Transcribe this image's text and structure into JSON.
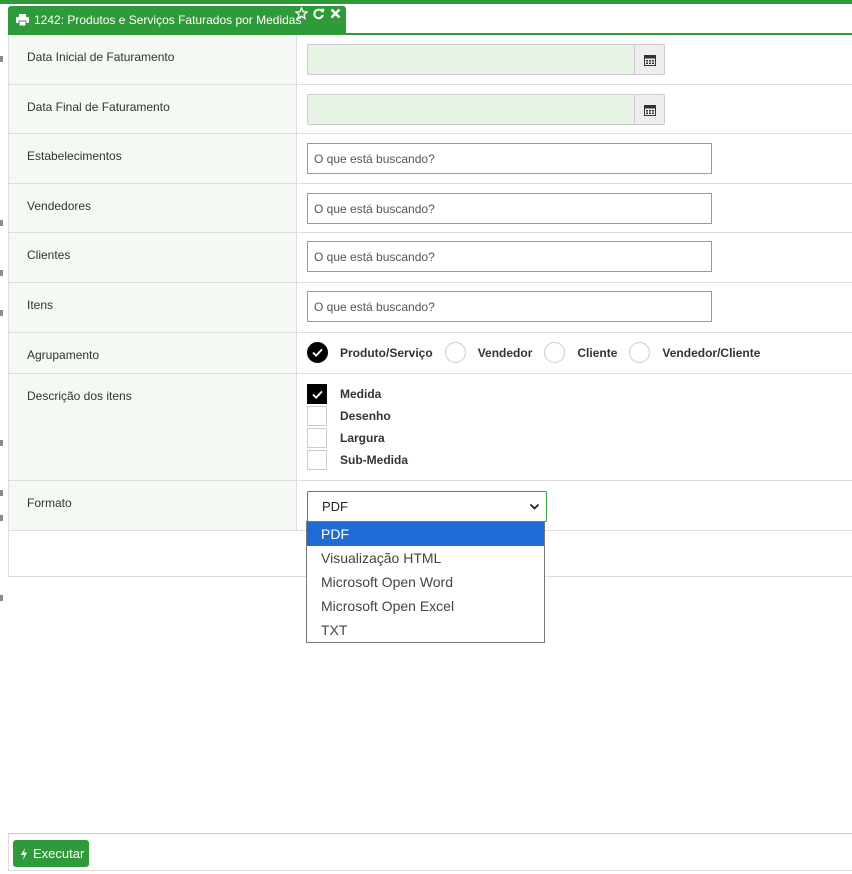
{
  "tab": {
    "title": "1242: Produtos e Serviços Faturados por Medidas",
    "icon": "printer-icon",
    "actions": [
      "star-icon",
      "refresh-icon",
      "close-icon"
    ]
  },
  "form": {
    "data_inicial": {
      "label": "Data Inicial de Faturamento",
      "value": ""
    },
    "data_final": {
      "label": "Data Final de Faturamento",
      "value": ""
    },
    "estabelecimentos": {
      "label": "Estabelecimentos",
      "placeholder": "O que está buscando?"
    },
    "vendedores": {
      "label": "Vendedores",
      "placeholder": "O que está buscando?"
    },
    "clientes": {
      "label": "Clientes",
      "placeholder": "O que está buscando?"
    },
    "itens": {
      "label": "Itens",
      "placeholder": "O que está buscando?"
    },
    "agrupamento": {
      "label": "Agrupamento",
      "options": [
        "Produto/Serviço",
        "Vendedor",
        "Cliente",
        "Vendedor/Cliente"
      ],
      "selected": "Produto/Serviço"
    },
    "descricao": {
      "label": "Descrição dos itens",
      "options": [
        {
          "label": "Medida",
          "checked": true
        },
        {
          "label": "Desenho",
          "checked": false
        },
        {
          "label": "Largura",
          "checked": false
        },
        {
          "label": "Sub-Medida",
          "checked": false
        }
      ]
    },
    "formato": {
      "label": "Formato",
      "selected": "PDF",
      "options": [
        "PDF",
        "Visualização HTML",
        "Microsoft Open Word",
        "Microsoft Open Excel",
        "TXT"
      ]
    }
  },
  "footer": {
    "execute_label": "Executar"
  },
  "colors": {
    "accent": "#2f9a3a",
    "label_bg": "#f4f9f3",
    "date_bg": "#e7f4e5",
    "selected_option": "#1f6bd6"
  }
}
